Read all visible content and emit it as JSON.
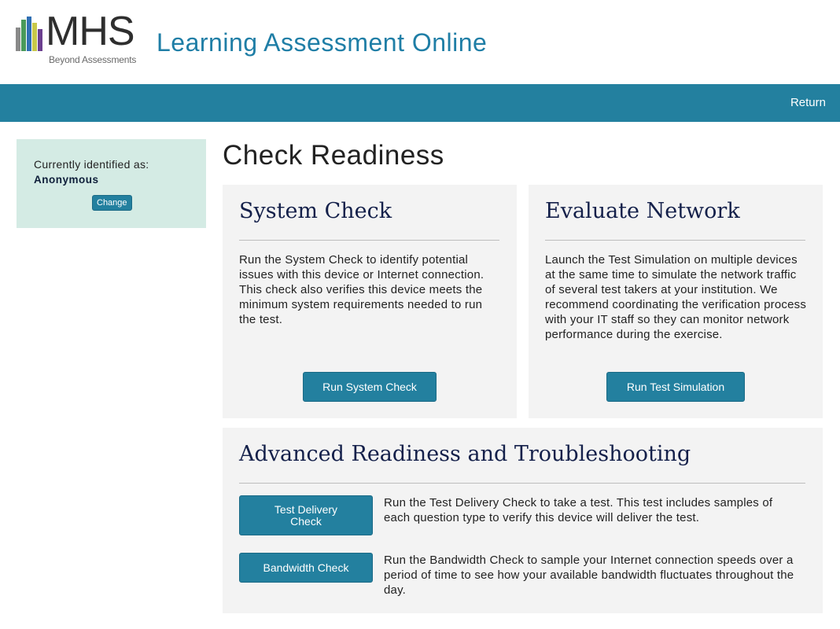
{
  "brand": {
    "logo_text": "MHS",
    "tagline": "Beyond Assessments",
    "app_title": "Learning Assessment Online",
    "bar_colors": [
      "#8a8a8a",
      "#4a9a5a",
      "#2f6fb3",
      "#c8c84a",
      "#6b3f8f"
    ]
  },
  "nav": {
    "return_label": "Return"
  },
  "identity": {
    "label": "Currently identified as:",
    "name": "Anonymous",
    "change_label": "Change"
  },
  "page": {
    "title": "Check Readiness"
  },
  "system_check": {
    "title": "System Check",
    "description": "Run the System Check to identify potential issues with this device or Internet connection. This check also verifies this device meets the minimum system requirements needed to run the test.",
    "button_label": "Run System Check"
  },
  "evaluate_network": {
    "title": "Evaluate Network",
    "description": "Launch the Test Simulation on multiple devices at the same time to simulate the network traffic of several test takers at your institution. We recommend coordinating the verification process with your IT staff so they can monitor network performance during the exercise.",
    "button_label": "Run Test Simulation"
  },
  "advanced": {
    "title": "Advanced Readiness and Troubleshooting",
    "items": [
      {
        "button_label": "Test Delivery Check",
        "description": "Run the Test Delivery Check to take a test. This test includes samples of each question type to verify this device will deliver the test."
      },
      {
        "button_label": "Bandwidth Check",
        "description": "Run the Bandwidth Check to sample your Internet connection speeds over a period of time to see how your available bandwidth fluctuates throughout the day."
      }
    ]
  },
  "colors": {
    "primary": "#23809f",
    "title_blue": "#1f7ea6",
    "card_bg": "#f3f3f3",
    "identity_bg": "#d4ebe4",
    "heading_navy": "#14204a"
  }
}
